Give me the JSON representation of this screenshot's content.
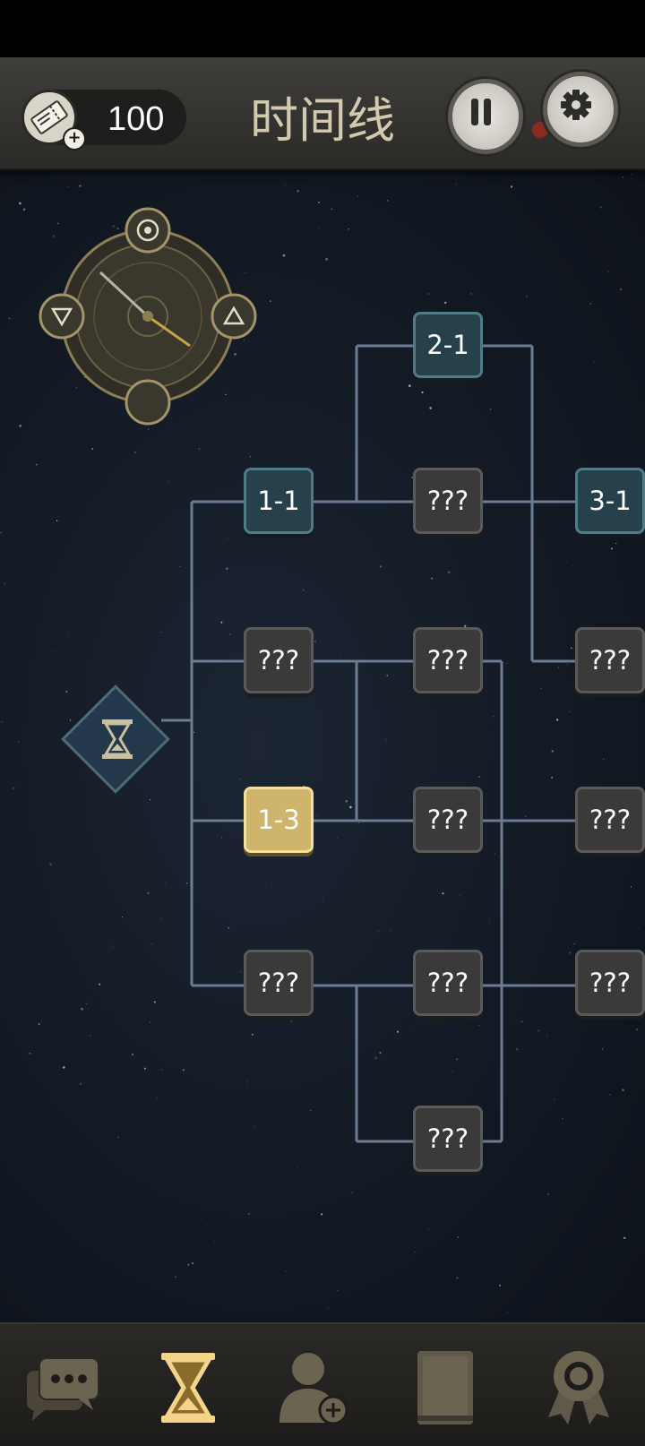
{
  "header": {
    "title": "时间线",
    "ticket_count": "100",
    "ticket_icon": "ticket-icon",
    "pause_icon": "pause-icon",
    "settings_icon": "gear-icon"
  },
  "colors": {
    "open_node": "#26414b",
    "locked_node": "#3a3a3b",
    "current_node": "#cfb46c",
    "connector_line": "#6c7c92",
    "title_text": "#d3c9ae"
  },
  "compass": {
    "top_icon": "target-icon",
    "left_icon": "triangle-down-icon",
    "right_icon": "triangle-up-icon",
    "bottom_icon": "crescent-moon-icon"
  },
  "timeline": {
    "start_icon": "hourglass-icon",
    "nodes": [
      {
        "id": "n-2-1",
        "label": "2-1",
        "state": "open"
      },
      {
        "id": "n-1-1",
        "label": "1-1",
        "state": "open"
      },
      {
        "id": "n-c2r2",
        "label": "???",
        "state": "locked"
      },
      {
        "id": "n-3-1",
        "label": "3-1",
        "state": "open"
      },
      {
        "id": "n-c1r3",
        "label": "???",
        "state": "locked"
      },
      {
        "id": "n-c2r3",
        "label": "???",
        "state": "locked"
      },
      {
        "id": "n-c3r3",
        "label": "???",
        "state": "locked"
      },
      {
        "id": "n-1-3",
        "label": "1-3",
        "state": "current"
      },
      {
        "id": "n-c2r4",
        "label": "???",
        "state": "locked"
      },
      {
        "id": "n-c3r4",
        "label": "???",
        "state": "locked"
      },
      {
        "id": "n-c1r5",
        "label": "???",
        "state": "locked"
      },
      {
        "id": "n-c2r5",
        "label": "???",
        "state": "locked"
      },
      {
        "id": "n-c3r5",
        "label": "???",
        "state": "locked"
      },
      {
        "id": "n-c2r6",
        "label": "???",
        "state": "locked"
      }
    ]
  },
  "bottom_nav": [
    {
      "icon": "chat-icon",
      "active": false
    },
    {
      "icon": "hourglass-icon",
      "active": true
    },
    {
      "icon": "add-user-icon",
      "active": false
    },
    {
      "icon": "book-icon",
      "active": false
    },
    {
      "icon": "medal-icon",
      "active": false
    }
  ]
}
